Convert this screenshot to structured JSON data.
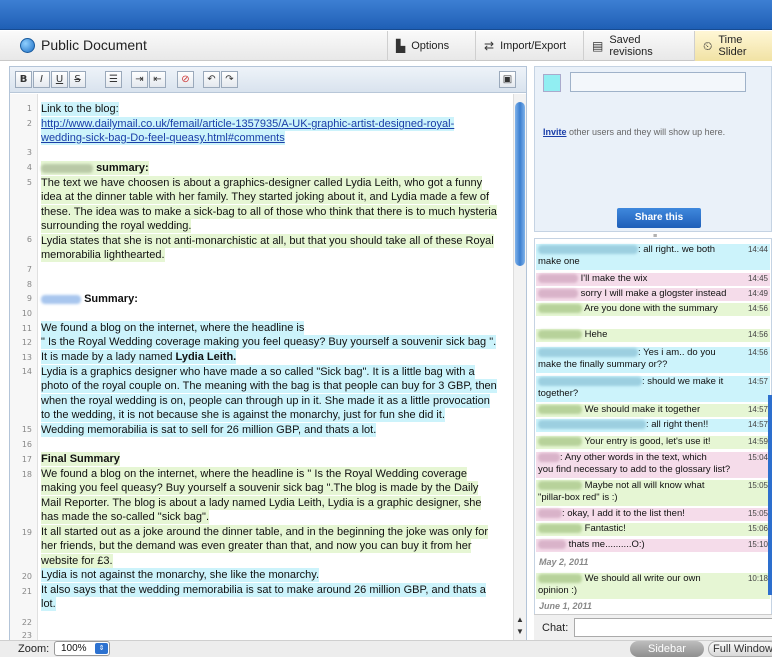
{
  "header": {
    "title": "Public Document",
    "options": "Options",
    "import_export": "Import/Export",
    "saved_revisions": "Saved revisions",
    "time_slider": "Time Slider"
  },
  "toolbar": {
    "bold": "B",
    "italic": "I",
    "underline": "U",
    "strike": "S"
  },
  "editor": {
    "line_numbers": [
      "1",
      "2",
      "3",
      "4",
      "5",
      "6",
      "7",
      "8",
      "9",
      "10",
      "11",
      "12",
      "13",
      "14",
      "15",
      "16",
      "17",
      "18",
      "19",
      "20",
      "21",
      "22",
      "23"
    ],
    "lines": [
      "Link to the blog:",
      "http://www.dailymail.co.uk/femail/article-1357935/A-UK-graphic-artist-designed-royal-",
      "wedding-sick-bag-Do-feel-queasy.html#comments",
      "summary:",
      "The text we have choosen is about a graphics-designer called Lydia Leith, who got a funny",
      "idea at the dinner table with her family. They started joking about it, and Lydia made a few of",
      "these. The idea was to make a sick-bag to all of those who think that there is to much hysteria",
      "surrounding the royal wedding.",
      "Lydia states that she is not anti-monarchistic at all, but that you should take all of these Royal",
      "memorabilia lighthearted.",
      "Summary:",
      "We found a blog on the internet, where the headline is",
      "\" Is the Royal Wedding coverage making you feel queasy? Buy yourself a souvenir sick bag \".",
      "It is made by a lady named ",
      "Lydia Leith.",
      "Lydia is a graphics designer who have made a so called \"Sick bag\". It is a little bag with a",
      "photo of the royal couple on. The meaning with the bag is that people can buy for 3 GBP, then",
      "when the royal wedding is on, people can through up in it. She made it as a little provocation",
      "to the wedding, it is not because she is against the monarchy, just for fun she did it.",
      "Wedding memorabilia is sat to sell for 26 million GBP, and thats a lot.",
      "Final Summary",
      "We found a blog on the internet, where the headline is \" Is the Royal Wedding coverage",
      "making you feel queasy? Buy yourself a souvenir sick bag \".The blog is made by the Daily",
      "Mail Reporter. The blog is about a lady named Lydia Leith, Lydia is a graphic designer, she",
      "has made the so-called \"sick bag\".",
      "It all started out as a joke around the dinner table, and in the beginning the joke was only for",
      "her friends, but the demand was even greater than that, and now you can buy it from her",
      "website for £3.",
      "Lydia is not against the monarchy, she like the monarchy.",
      "It also says that the wedding memorabilia is sat to make around 26 million GBP, and thats a",
      "lot."
    ]
  },
  "users": {
    "invite_link": "Invite",
    "invite_text": " other users and they will show up here.",
    "share_button": "Share this"
  },
  "chat": {
    "messages": [
      {
        "text": ": all right.. we both",
        "text2": "make one",
        "time": "14:44"
      },
      {
        "text": "I'll make the wix",
        "time": "14:45"
      },
      {
        "text": "sorry I will make a glogster instead",
        "time": "14:49"
      },
      {
        "text": "Are you done with the summary",
        "time": "14:56"
      },
      {
        "text": "Hehe",
        "time": "14:56"
      },
      {
        "text": ": Yes i am.. do you",
        "text2": "make the finally summary or??",
        "time": "14:56"
      },
      {
        "text": ": should we make it",
        "text2": "together?",
        "time": "14:57"
      },
      {
        "text": "We should make it together",
        "time": "14:57"
      },
      {
        "text": ": all right then!!",
        "time": "14:57"
      },
      {
        "text": "Your entry is good, let's use it!",
        "time": "14:59"
      },
      {
        "text": ": Any other words in the text, which",
        "text2": "you find necessary to add to the glossary list?",
        "time": "15:04"
      },
      {
        "text": "Maybe not all will know what",
        "text2": "\"pillar-box red\" is :)",
        "time": "15:05"
      },
      {
        "text": ": okay, I add it to the list then!",
        "time": "15:05"
      },
      {
        "text": "Fantastic!",
        "time": "15:06"
      },
      {
        "text": "thats me..........O:)",
        "time": "15:10"
      },
      {
        "text": "We should all write our own",
        "text2": "opinion :)",
        "time": "10:18"
      }
    ],
    "dates": [
      "May 2, 2011",
      "June 1, 2011"
    ],
    "label": "Chat:"
  },
  "footer": {
    "zoom_label": "Zoom:",
    "zoom_value": "100%",
    "sidebar": "Sidebar",
    "full_window": "Full Window"
  },
  "colors": {
    "author_a": "#ccf3fb",
    "author_b": "#e6f6d4",
    "chat_pink": "#f5dcea",
    "accent": "#2d72d0"
  }
}
